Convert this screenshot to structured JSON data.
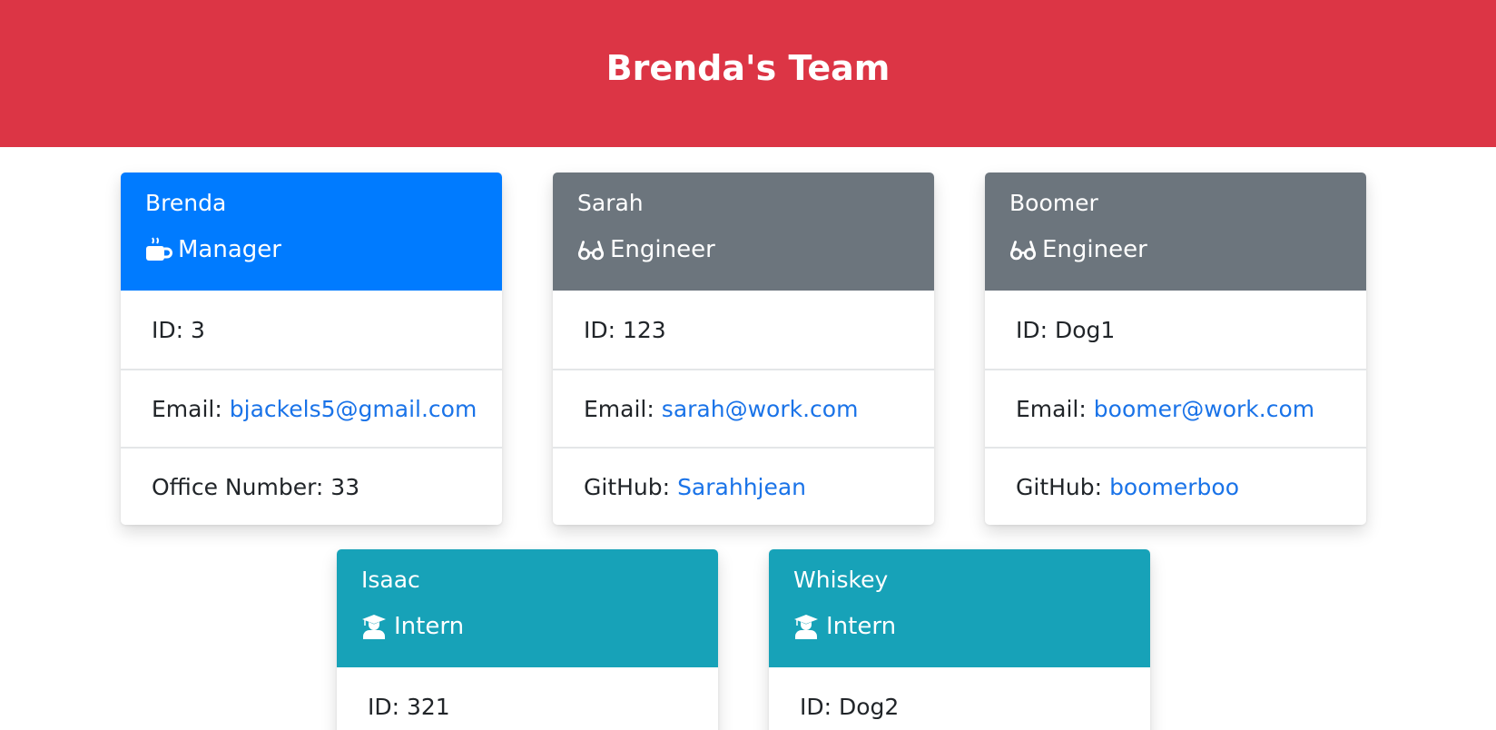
{
  "header": {
    "title": "Brenda's Team"
  },
  "team": [
    {
      "name": "Brenda",
      "role": "Manager",
      "icon": "mug-icon",
      "color": "#007bff",
      "id_label": "ID:",
      "id": "3",
      "email_label": "Email:",
      "email": "bjackels5@gmail.com",
      "extra_label": "Office Number:",
      "extra": "33"
    },
    {
      "name": "Sarah",
      "role": "Engineer",
      "icon": "glasses-icon",
      "color": "#6c757d",
      "id_label": "ID:",
      "id": "123",
      "email_label": "Email:",
      "email": "sarah@work.com",
      "extra_label": "GitHub:",
      "extra": "Sarahhjean"
    },
    {
      "name": "Boomer",
      "role": "Engineer",
      "icon": "glasses-icon",
      "color": "#6c757d",
      "id_label": "ID:",
      "id": "Dog1",
      "email_label": "Email:",
      "email": "boomer@work.com",
      "extra_label": "GitHub:",
      "extra": "boomerboo"
    },
    {
      "name": "Isaac",
      "role": "Intern",
      "icon": "graduate-icon",
      "color": "#17a2b8",
      "id_label": "ID:",
      "id": "321"
    },
    {
      "name": "Whiskey",
      "role": "Intern",
      "icon": "graduate-icon",
      "color": "#17a2b8",
      "id_label": "ID:",
      "id": "Dog2"
    }
  ],
  "colors": {
    "banner": "#dc3545",
    "link": "#1a73e8"
  }
}
